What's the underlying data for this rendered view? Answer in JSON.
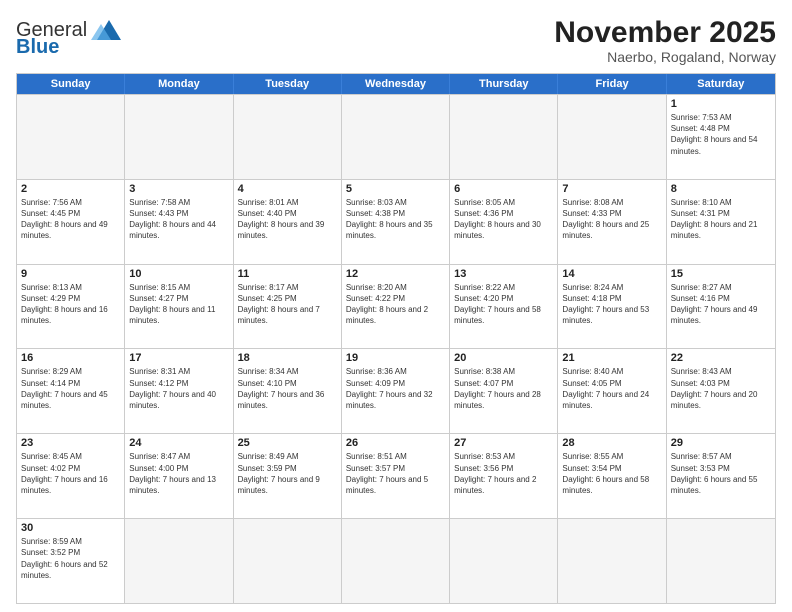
{
  "header": {
    "logo_general": "General",
    "logo_blue": "Blue",
    "month_title": "November 2025",
    "location": "Naerbo, Rogaland, Norway"
  },
  "days_of_week": [
    "Sunday",
    "Monday",
    "Tuesday",
    "Wednesday",
    "Thursday",
    "Friday",
    "Saturday"
  ],
  "weeks": [
    [
      {
        "day": "",
        "info": "",
        "empty": true
      },
      {
        "day": "",
        "info": "",
        "empty": true
      },
      {
        "day": "",
        "info": "",
        "empty": true
      },
      {
        "day": "",
        "info": "",
        "empty": true
      },
      {
        "day": "",
        "info": "",
        "empty": true
      },
      {
        "day": "",
        "info": "",
        "empty": true
      },
      {
        "day": "1",
        "info": "Sunrise: 7:53 AM\nSunset: 4:48 PM\nDaylight: 8 hours and 54 minutes.",
        "empty": false
      }
    ],
    [
      {
        "day": "2",
        "info": "Sunrise: 7:56 AM\nSunset: 4:45 PM\nDaylight: 8 hours and 49 minutes.",
        "empty": false
      },
      {
        "day": "3",
        "info": "Sunrise: 7:58 AM\nSunset: 4:43 PM\nDaylight: 8 hours and 44 minutes.",
        "empty": false
      },
      {
        "day": "4",
        "info": "Sunrise: 8:01 AM\nSunset: 4:40 PM\nDaylight: 8 hours and 39 minutes.",
        "empty": false
      },
      {
        "day": "5",
        "info": "Sunrise: 8:03 AM\nSunset: 4:38 PM\nDaylight: 8 hours and 35 minutes.",
        "empty": false
      },
      {
        "day": "6",
        "info": "Sunrise: 8:05 AM\nSunset: 4:36 PM\nDaylight: 8 hours and 30 minutes.",
        "empty": false
      },
      {
        "day": "7",
        "info": "Sunrise: 8:08 AM\nSunset: 4:33 PM\nDaylight: 8 hours and 25 minutes.",
        "empty": false
      },
      {
        "day": "8",
        "info": "Sunrise: 8:10 AM\nSunset: 4:31 PM\nDaylight: 8 hours and 21 minutes.",
        "empty": false
      }
    ],
    [
      {
        "day": "9",
        "info": "Sunrise: 8:13 AM\nSunset: 4:29 PM\nDaylight: 8 hours and 16 minutes.",
        "empty": false
      },
      {
        "day": "10",
        "info": "Sunrise: 8:15 AM\nSunset: 4:27 PM\nDaylight: 8 hours and 11 minutes.",
        "empty": false
      },
      {
        "day": "11",
        "info": "Sunrise: 8:17 AM\nSunset: 4:25 PM\nDaylight: 8 hours and 7 minutes.",
        "empty": false
      },
      {
        "day": "12",
        "info": "Sunrise: 8:20 AM\nSunset: 4:22 PM\nDaylight: 8 hours and 2 minutes.",
        "empty": false
      },
      {
        "day": "13",
        "info": "Sunrise: 8:22 AM\nSunset: 4:20 PM\nDaylight: 7 hours and 58 minutes.",
        "empty": false
      },
      {
        "day": "14",
        "info": "Sunrise: 8:24 AM\nSunset: 4:18 PM\nDaylight: 7 hours and 53 minutes.",
        "empty": false
      },
      {
        "day": "15",
        "info": "Sunrise: 8:27 AM\nSunset: 4:16 PM\nDaylight: 7 hours and 49 minutes.",
        "empty": false
      }
    ],
    [
      {
        "day": "16",
        "info": "Sunrise: 8:29 AM\nSunset: 4:14 PM\nDaylight: 7 hours and 45 minutes.",
        "empty": false
      },
      {
        "day": "17",
        "info": "Sunrise: 8:31 AM\nSunset: 4:12 PM\nDaylight: 7 hours and 40 minutes.",
        "empty": false
      },
      {
        "day": "18",
        "info": "Sunrise: 8:34 AM\nSunset: 4:10 PM\nDaylight: 7 hours and 36 minutes.",
        "empty": false
      },
      {
        "day": "19",
        "info": "Sunrise: 8:36 AM\nSunset: 4:09 PM\nDaylight: 7 hours and 32 minutes.",
        "empty": false
      },
      {
        "day": "20",
        "info": "Sunrise: 8:38 AM\nSunset: 4:07 PM\nDaylight: 7 hours and 28 minutes.",
        "empty": false
      },
      {
        "day": "21",
        "info": "Sunrise: 8:40 AM\nSunset: 4:05 PM\nDaylight: 7 hours and 24 minutes.",
        "empty": false
      },
      {
        "day": "22",
        "info": "Sunrise: 8:43 AM\nSunset: 4:03 PM\nDaylight: 7 hours and 20 minutes.",
        "empty": false
      }
    ],
    [
      {
        "day": "23",
        "info": "Sunrise: 8:45 AM\nSunset: 4:02 PM\nDaylight: 7 hours and 16 minutes.",
        "empty": false
      },
      {
        "day": "24",
        "info": "Sunrise: 8:47 AM\nSunset: 4:00 PM\nDaylight: 7 hours and 13 minutes.",
        "empty": false
      },
      {
        "day": "25",
        "info": "Sunrise: 8:49 AM\nSunset: 3:59 PM\nDaylight: 7 hours and 9 minutes.",
        "empty": false
      },
      {
        "day": "26",
        "info": "Sunrise: 8:51 AM\nSunset: 3:57 PM\nDaylight: 7 hours and 5 minutes.",
        "empty": false
      },
      {
        "day": "27",
        "info": "Sunrise: 8:53 AM\nSunset: 3:56 PM\nDaylight: 7 hours and 2 minutes.",
        "empty": false
      },
      {
        "day": "28",
        "info": "Sunrise: 8:55 AM\nSunset: 3:54 PM\nDaylight: 6 hours and 58 minutes.",
        "empty": false
      },
      {
        "day": "29",
        "info": "Sunrise: 8:57 AM\nSunset: 3:53 PM\nDaylight: 6 hours and 55 minutes.",
        "empty": false
      }
    ],
    [
      {
        "day": "30",
        "info": "Sunrise: 8:59 AM\nSunset: 3:52 PM\nDaylight: 6 hours and 52 minutes.",
        "empty": false
      },
      {
        "day": "",
        "info": "",
        "empty": true
      },
      {
        "day": "",
        "info": "",
        "empty": true
      },
      {
        "day": "",
        "info": "",
        "empty": true
      },
      {
        "day": "",
        "info": "",
        "empty": true
      },
      {
        "day": "",
        "info": "",
        "empty": true
      },
      {
        "day": "",
        "info": "",
        "empty": true
      }
    ]
  ]
}
